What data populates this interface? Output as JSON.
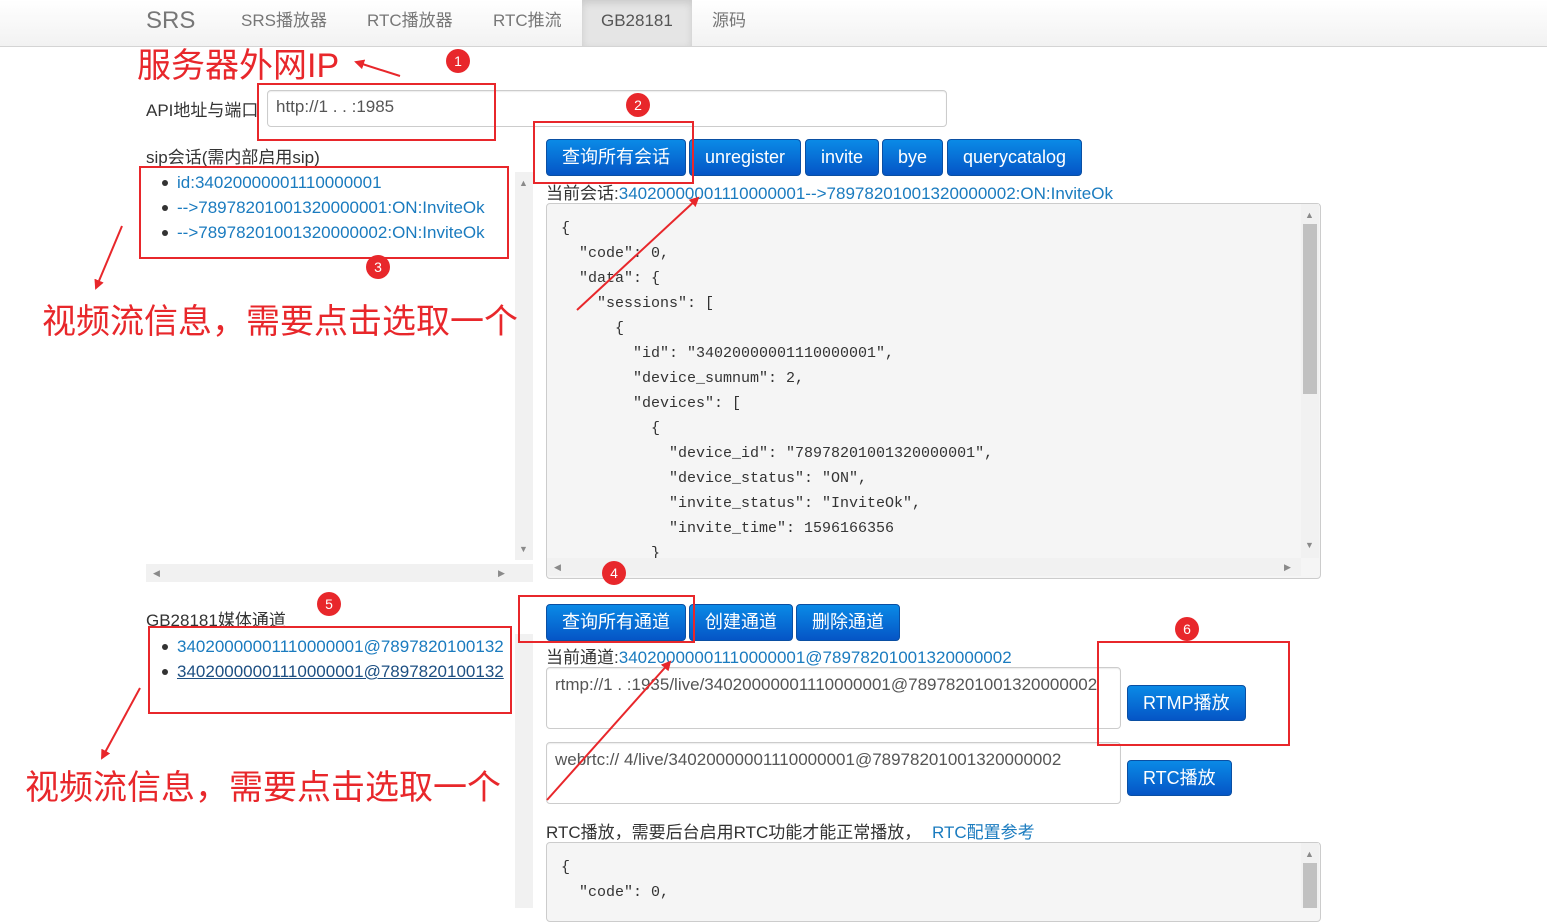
{
  "navbar": {
    "brand": "SRS",
    "items": [
      "SRS播放器",
      "RTC播放器",
      "RTC推流",
      "GB28181",
      "源码"
    ],
    "active": "GB28181"
  },
  "api": {
    "label": "API地址与端口",
    "value": "http://1  .   .  :1985"
  },
  "sip": {
    "title": "sip会话(需内部启用sip)",
    "items": [
      "id:34020000001110000001",
      "-->78978201001320000001:ON:InviteOk",
      "-->78978201001320000002:ON:InviteOk"
    ],
    "buttons": [
      "查询所有会话",
      "unregister",
      "invite",
      "bye",
      "querycatalog"
    ],
    "current_label": "当前会话:",
    "current_value": "34020000001110000001-->78978201001320000002:ON:InviteOk",
    "json": "{\n  \"code\": 0,\n  \"data\": {\n    \"sessions\": [\n      {\n        \"id\": \"34020000001110000001\",\n        \"device_sumnum\": 2,\n        \"devices\": [\n          {\n            \"device_id\": \"78978201001320000001\",\n            \"device_status\": \"ON\",\n            \"invite_status\": \"InviteOk\",\n            \"invite_time\": 1596166356\n          }"
  },
  "media": {
    "title": "GB28181媒体通道",
    "items": [
      "34020000001110000001@7897820100132",
      "34020000001110000001@7897820100132"
    ],
    "buttons": [
      "查询所有通道",
      "创建通道",
      "删除通道"
    ],
    "current_label": "当前通道:",
    "current_value": "34020000001110000001@78978201001320000002",
    "rtmp_url": "rtmp://1      .       :1935/live/34020000001110000001@78978201001320000002",
    "rtmp_button": "RTMP播放",
    "webrtc_url": "webrtc://              4/live/34020000001110000001@78978201001320000002",
    "rtc_button": "RTC播放",
    "rtc_note": "RTC播放，需要后台启用RTC功能才能正常播放，",
    "rtc_link": "RTC配置参考",
    "json": "{\n  \"code\": 0,"
  },
  "annotations": {
    "server_ip": "服务器外网IP",
    "select_stream_1": "视频流信息，需要点击选取一个",
    "select_stream_2": "视频流信息，需要点击选取一个",
    "badges": [
      "1",
      "2",
      "3",
      "4",
      "5",
      "6"
    ],
    "color": "#e8272b"
  }
}
